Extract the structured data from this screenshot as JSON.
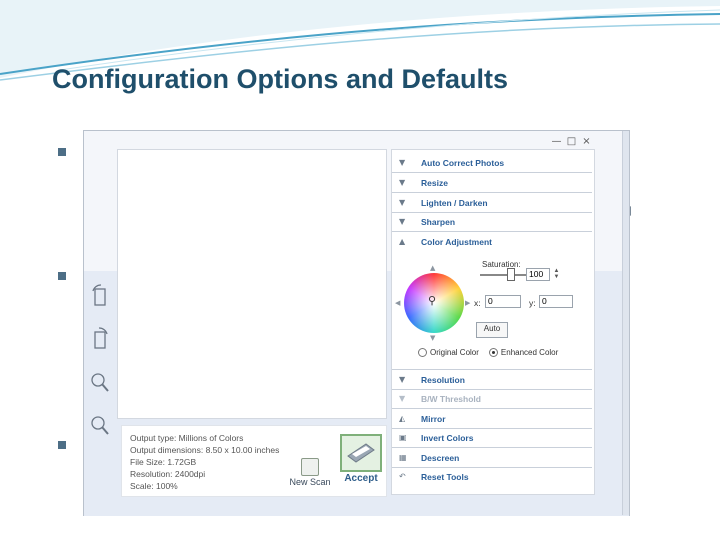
{
  "slide": {
    "title": "Configuration Options and Defaults"
  },
  "window": {
    "controls": {
      "minimize": "—",
      "maximize": "□",
      "close": "×"
    }
  },
  "info": {
    "output_type": "Output type: Millions of Colors",
    "output_dimensions": "Output dimensions: 8.50 x 10.00 inches",
    "file_size": "File Size: 1.72GB",
    "resolution": "Resolution: 2400dpi",
    "scale": "Scale: 100%"
  },
  "buttons": {
    "new_scan": "New Scan",
    "accept": "Accept"
  },
  "tools": [
    {
      "label": "Auto Correct Photos",
      "icon": "triangle-down-icon",
      "glyph": "▼",
      "disabled": false
    },
    {
      "label": "Resize",
      "icon": "triangle-down-icon",
      "glyph": "▼",
      "disabled": false
    },
    {
      "label": "Lighten / Darken",
      "icon": "triangle-down-icon",
      "glyph": "▼",
      "disabled": false
    },
    {
      "label": "Sharpen",
      "icon": "triangle-down-icon",
      "glyph": "▼",
      "disabled": false
    },
    {
      "label": "Color Adjustment",
      "icon": "triangle-up-icon",
      "glyph": "▲",
      "disabled": false
    }
  ],
  "color_adjustment": {
    "saturation_label": "Saturation:",
    "saturation_value": "100",
    "x_label": "x:",
    "x_value": "0",
    "y_label": "y:",
    "y_value": "0",
    "auto_label": "Auto",
    "original_color": "Original Color",
    "enhanced_color": "Enhanced Color",
    "selected": "Enhanced Color"
  },
  "tools_lower": [
    {
      "label": "Resolution",
      "icon": "triangle-down-icon",
      "glyph": "▼",
      "disabled": false
    },
    {
      "label": "B/W Threshold",
      "icon": "triangle-down-icon",
      "glyph": "▼",
      "disabled": true
    },
    {
      "label": "Mirror",
      "icon": "mirror-icon",
      "glyph": "◭",
      "disabled": false
    },
    {
      "label": "Invert Colors",
      "icon": "invert-icon",
      "glyph": "▣",
      "disabled": false
    },
    {
      "label": "Descreen",
      "icon": "descreen-icon",
      "glyph": "▦",
      "disabled": false
    },
    {
      "label": "Reset Tools",
      "icon": "reset-icon",
      "glyph": "↶",
      "disabled": false
    }
  ]
}
